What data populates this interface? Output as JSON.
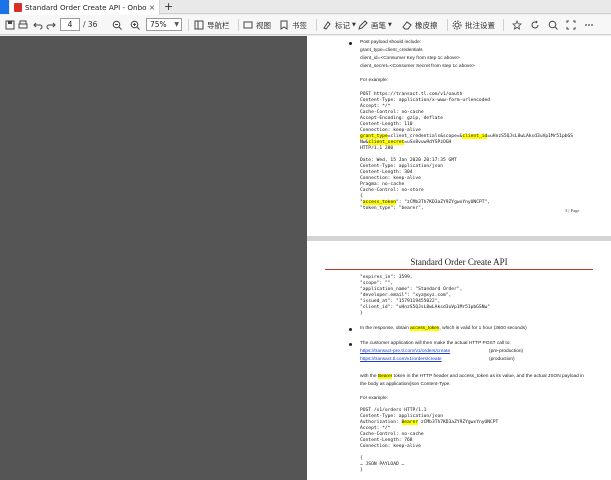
{
  "tab": {
    "title": "Standard Order Create API - Onboarding...",
    "close": "×",
    "new_tab": "+"
  },
  "toolbar": {
    "page_current": "4",
    "page_total": "/ 36",
    "zoom": "75%",
    "nav_pane": "导航栏",
    "view": "视图",
    "bookmark": "书签",
    "mark": "标记",
    "draw": "画笔",
    "eraser": "橡皮擦",
    "annotation_settings": "批注设置"
  },
  "page1": {
    "bullet1_line1": "Post payload should include:",
    "bullet1_line2": "grant_type=client_credentials",
    "bullet1_line3": "client_id=<Consumer Key from step 1c above>",
    "bullet1_line4": "client_secret=<Consumer Secret from step 1c above>",
    "example": "For example:",
    "code": [
      "POST https://transact.tl.com/v1/oauth",
      "Content-Type: application/x-www-form-urlencoded",
      "Accept: */*",
      "Cache-Control: no-cache",
      "Accept-Encoding: gzip, deflate",
      "Content-Length: 110",
      "Connection: keep-alive"
    ],
    "code_hl1_a": "grant_type",
    "code_hl1_b": "=client_credentials&scope=&",
    "code_hl1_c": "client_id",
    "code_hl1_d": "=uHnzS5QJsL8wLAksd3uVp1Mr51pbGS",
    "code_hl2_a": "Nw&",
    "code_hl2_b": "client_secret",
    "code_hl2_c": "=uSv8vuw9dYSPzOGH",
    "code_after": "HTTP/1.1 200",
    "code2": [
      "Date: Wed, 15 Jan 2020 20:17:35 GMT",
      "Content-Type: application/json",
      "Content-Length: 304",
      "Connection: keep-alive",
      "Pragma: no-cache",
      "Cache-Control: no-store",
      "{"
    ],
    "token_a": "\"",
    "token_b": "access_token",
    "token_c": "\": \"zCMb3Th7KD3aZY9ZYgwxYnyUNCPT\",",
    "token_type": "\"token_type\": \"bearer\",",
    "page_label": "3 | Page"
  },
  "page2": {
    "title": "Standard Order Create API",
    "code": [
      "\"expires_in\": 3599,",
      "\"scope\": \"\",",
      "\"application_name\": \"Standard Order\",",
      "\"developer.email\": \"xyz@xyz.com\",",
      "\"issued_at\": \"1579119455022\",",
      "\"client_id\": \"uHnzS5QJsL8wLAksd3uVp1Mr51pbGSNw\"",
      "}"
    ],
    "b1_a": "In the response, obtain ",
    "b1_b": "access_token",
    "b1_c": ", which is valid for 1 hour (3600 seconds)",
    "b2_line1": "The customer application will then make the actual HTTP POST call to:",
    "link1": "https://transact-pre.tl.com/v1/orders/create",
    "link1_note": "(pre-production)",
    "link2": "https://transact.tl.com/v1/orders/create",
    "link2_note": "(production)",
    "para_a": "with the ",
    "para_b": "Bearer",
    "para_c": " token in the HTTP header and access_token as its value, and the actual JSON payload in",
    "para_line2": "the body as application/json Content-Type.",
    "example": "For example:",
    "code2_1": "POST /v1/orders HTTP/1.1",
    "code2_2": "Content-Type: application/json",
    "code2_3a": "Authorization: ",
    "code2_3b": "Bearer",
    "code2_3c": " zCMb3Th7KD3aZY9ZYgwxYnyUNCPT",
    "code2_rest": [
      "Accept: */*",
      "Cache-Control: no-cache",
      "Content-Length: 768",
      "Connection: keep-alive"
    ],
    "payload": [
      "{",
      "… JSON PAYLOAD …",
      "}"
    ]
  }
}
